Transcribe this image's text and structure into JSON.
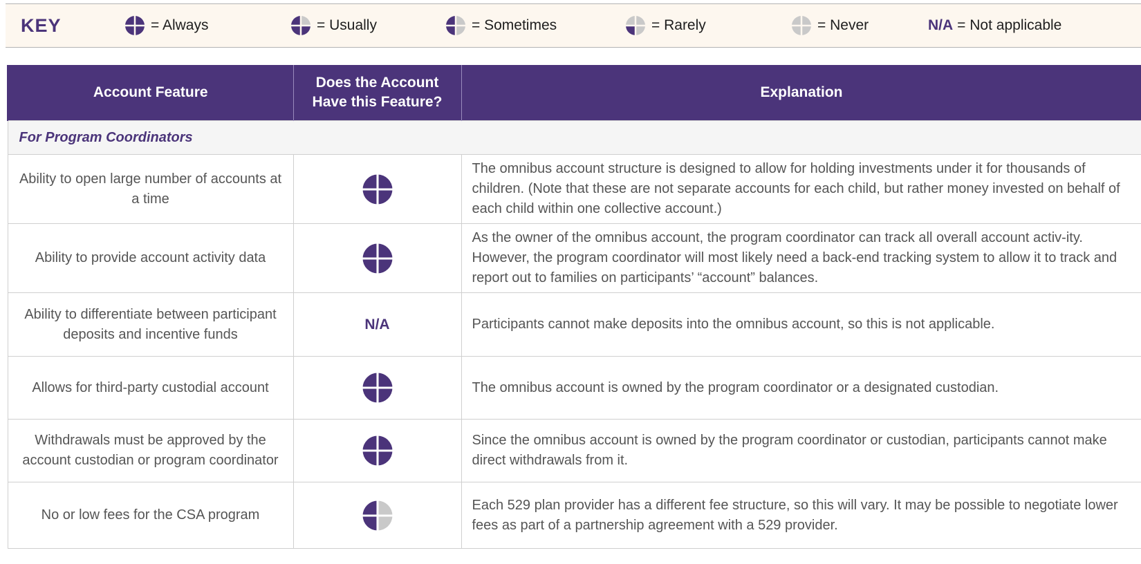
{
  "key": {
    "title": "KEY",
    "items": [
      {
        "icon": "always-icon",
        "label": "= Always"
      },
      {
        "icon": "usually-icon",
        "label": "= Usually"
      },
      {
        "icon": "sometimes-icon",
        "label": "= Sometimes"
      },
      {
        "icon": "rarely-icon",
        "label": "= Rarely"
      },
      {
        "icon": "never-icon",
        "label": "= Never"
      }
    ],
    "na": {
      "abbr": "N/A",
      "label": "= Not applicable"
    }
  },
  "colors": {
    "brand_purple": "#4b347a",
    "empty_gray": "#c9c9c9",
    "key_background": "#fdf7ef"
  },
  "table": {
    "headers": [
      "Account Feature",
      "Does the Account Have this Feature?",
      "Explanation"
    ],
    "section": "For Program Coordinators",
    "rows": [
      {
        "feature": "Ability to open large number of accounts at a time",
        "status": "always",
        "explanation": "The omnibus account structure is designed to allow for holding investments under it for thousands of children. (Note that these are not separate accounts for each child, but rather money invested on behalf of each child within one collective account.)"
      },
      {
        "feature": "Ability to provide account activity data",
        "status": "always",
        "explanation": "As the owner of the omnibus account, the program coordinator can track all overall account activ-ity. However, the program coordinator will most likely need a back-end tracking system to allow it to track and report out to families on participants’ “account” balances."
      },
      {
        "feature": "Ability to differentiate between participant deposits and incentive funds",
        "status": "na",
        "status_text": "N/A",
        "explanation": "Participants cannot make deposits into the omnibus account, so this is not applicable."
      },
      {
        "feature": "Allows for third-party custodial account",
        "status": "always",
        "explanation": "The omnibus account is owned by the program coordinator or a designated custodian."
      },
      {
        "feature": "Withdrawals must be approved by the account custodian or program coordinator",
        "status": "always",
        "explanation": "Since the omnibus account is owned by the program coordinator or custodian, participants cannot make direct withdrawals from it."
      },
      {
        "feature": "No or low fees for the CSA program",
        "status": "sometimes",
        "explanation": "Each 529 plan provider has a different fee structure, so this will vary. It may be possible to negotiate lower fees as part of a partnership agreement with a 529 provider."
      }
    ]
  }
}
